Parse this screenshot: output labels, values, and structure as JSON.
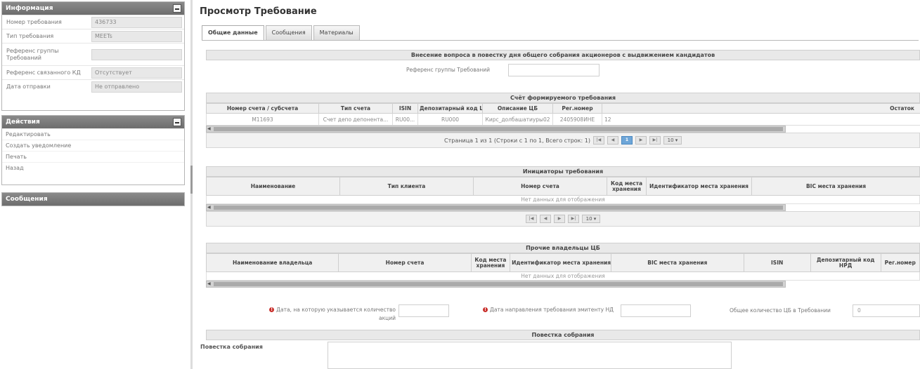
{
  "info_panel": {
    "title": "Информация",
    "rows": [
      {
        "label": "Номер требования",
        "value": "436733"
      },
      {
        "label": "Тип требования",
        "value": "MEETs"
      },
      {
        "label": "Референс группы Требований",
        "value": ""
      },
      {
        "label": "Референс связанного КД",
        "value": "Отсутствует"
      },
      {
        "label": "Дата отправки",
        "value": "Не отправлено"
      }
    ]
  },
  "actions_panel": {
    "title": "Действия",
    "items": [
      "Редактировать",
      "Создать уведомление",
      "Печать",
      "Назад"
    ]
  },
  "messages_panel": {
    "title": "Сообщения"
  },
  "page": {
    "title": "Просмотр Требование",
    "tabs": [
      "Общие данные",
      "Сообщения",
      "Материалы"
    ]
  },
  "section_main": {
    "title": "Внесение вопроса в повестку дня общего собрания акционеров с выдвижением кандидатов",
    "group_ref_label": "Референс группы Требований",
    "group_ref_value": ""
  },
  "account_table": {
    "title": "Счёт формируемого требования",
    "columns": [
      "Номер счета / субсчета",
      "Тип счета",
      "ISIN",
      "Депозитарный код ЦБ",
      "Описание ЦБ",
      "Рег.номер",
      "Остаток"
    ],
    "rows": [
      [
        "M11693",
        "Счет депо депонента...",
        "RU00...",
        "RU000",
        "Кирс_долбашатиуры02",
        "2405908ИНЕ",
        "12"
      ]
    ],
    "pager": {
      "text": "Страница 1 из 1 (Строки с 1 по 1, Всего строк: 1)",
      "current": "1",
      "page_size": "10"
    }
  },
  "initiators_table": {
    "title": "Инициаторы требования",
    "columns": [
      "Наименование",
      "Тип клиента",
      "Номер счета",
      "Код места хранения",
      "Идентификатор места хранения",
      "BIC места хранения"
    ],
    "empty_text": "Нет данных для отображения",
    "pager": {
      "page_size": "10"
    }
  },
  "owners_table": {
    "title": "Прочие владельцы ЦБ",
    "columns": [
      "Наименование владельца",
      "Номер счета",
      "Код места хранения",
      "Идентификатор места хранения",
      "BIC места хранения",
      "ISIN",
      "Депозитарный код НРД",
      "Рег.номер"
    ],
    "empty_text": "Нет данных для отображения"
  },
  "dates": {
    "date_owners_label": "Дата, на которую указывается количество акций",
    "date_sent_label": "Дата направления требования эмитенту НД",
    "total_label": "Общее количество ЦБ в Требовании",
    "total_value": "0"
  },
  "agenda": {
    "title": "Повестка собрания",
    "label": "Повестка собрания",
    "value": ""
  }
}
